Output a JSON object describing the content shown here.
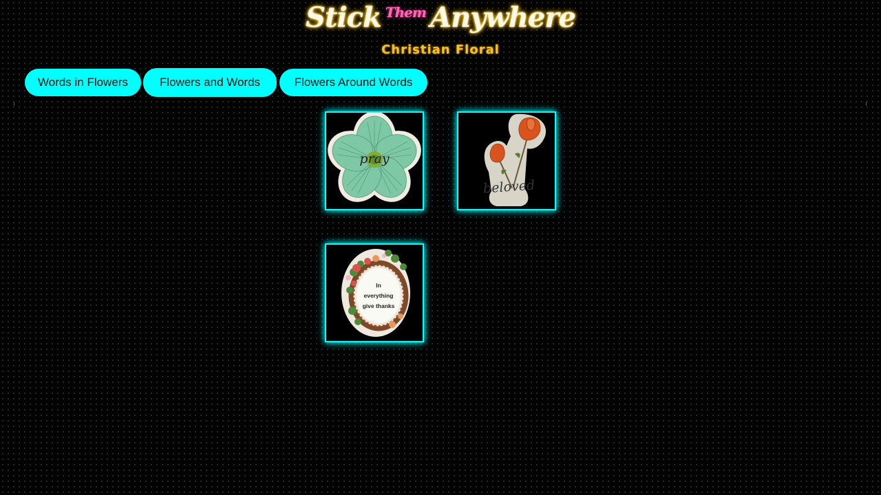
{
  "header": {
    "title_part1": "Stick",
    "title_part2": "Them",
    "title_part3": "Anywhere",
    "subtitle": "Christian Floral"
  },
  "nav": {
    "items": [
      {
        "label": "Words in Flowers"
      },
      {
        "label": "Flowers and Words"
      },
      {
        "label": "Flowers Around Words"
      }
    ]
  },
  "gallery": {
    "items": [
      {
        "name": "sticker-pray",
        "text": "pray"
      },
      {
        "name": "sticker-beloved",
        "text": "beloved"
      },
      {
        "name": "sticker-give-thanks",
        "text_lines": [
          "In",
          "everything",
          "give thanks"
        ]
      }
    ]
  },
  "colors": {
    "accent": "#00ffff",
    "title": "#fff8e6",
    "title_glow": "#ffd54a",
    "them": "#ff69b4",
    "subtitle": "#f6c026",
    "background": "#000000"
  }
}
